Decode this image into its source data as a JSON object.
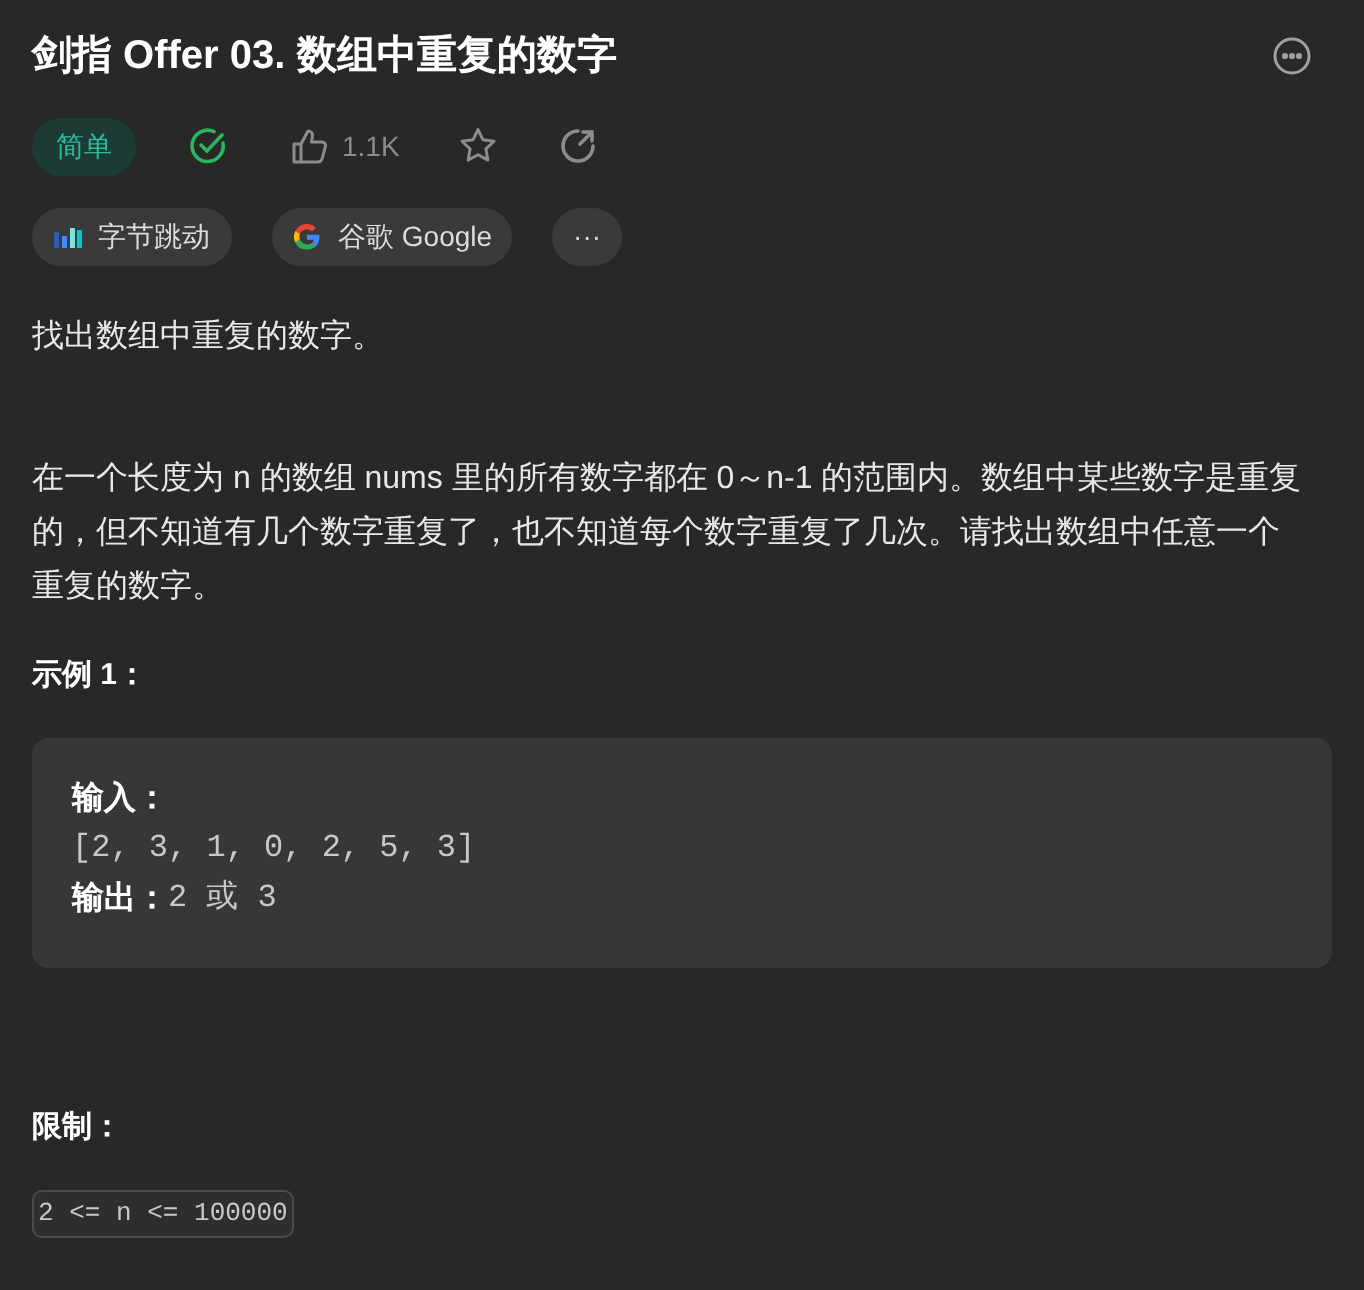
{
  "title": "剑指 Offer 03. 数组中重复的数字",
  "difficulty": "简单",
  "solved": true,
  "likes": "1.1K",
  "tags": [
    {
      "kind": "bytedance",
      "label": "字节跳动"
    },
    {
      "kind": "google",
      "label": "谷歌 Google"
    },
    {
      "kind": "more",
      "label": "···"
    }
  ],
  "intro": "找出数组中重复的数字。",
  "description": "在一个长度为 n 的数组 nums 里的所有数字都在 0～n-1 的范围内。数组中某些数字是重复的，但不知道有几个数字重复了，也不知道每个数字重复了几次。请找出数组中任意一个重复的数字。",
  "example": {
    "heading": "示例 1：",
    "input_label": "输入：",
    "input": "[2, 3, 1, 0, 2, 5, 3]",
    "output_label": "输出：",
    "output": "2 或 3"
  },
  "limits": {
    "heading": "限制：",
    "code": "2 <= n <= 100000"
  }
}
